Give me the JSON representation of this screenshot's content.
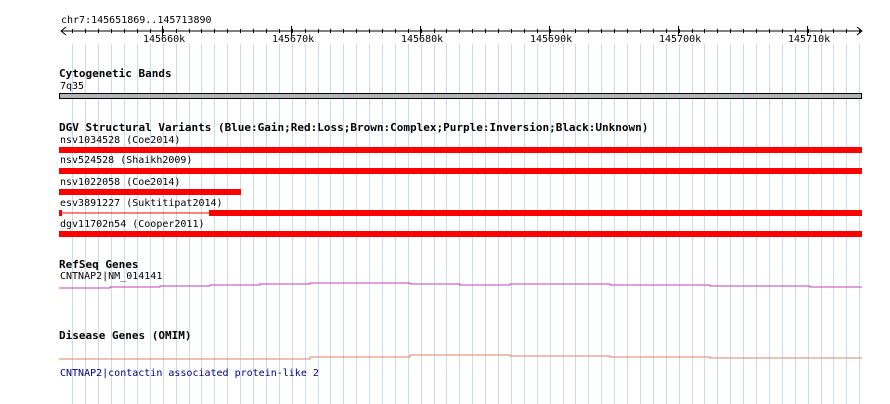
{
  "header": {
    "region": "chr7:145651869..145713890",
    "ticks": [
      "145660k",
      "145670k",
      "145680k",
      "145690k",
      "145700k",
      "145710k"
    ]
  },
  "tracks": {
    "cytoband": {
      "title": "Cytogenetic Bands",
      "band": "7q35"
    },
    "dgv": {
      "title": "DGV Structural Variants (Blue:Gain;Red:Loss;Brown:Complex;Purple:Inversion;Black:Unknown)",
      "variants": [
        "nsv1034528 (Coe2014)",
        "nsv524528 (Shaikh2009)",
        "nsv1022058 (Coe2014)",
        "esv3891227 (Suktitipat2014)",
        "dgv11702n54 (Cooper2011)"
      ]
    },
    "refseq": {
      "title": "RefSeq Genes",
      "gene": "CNTNAP2|NM_014141"
    },
    "omim": {
      "title": "Disease Genes (OMIM)",
      "gene": "CNTNAP2|contactin associated protein-like 2"
    }
  },
  "colors": {
    "loss": "#ff0000",
    "refseq": "#c040c0",
    "omim": "#e08060",
    "grid": "#c8dcf0",
    "link": "#000080"
  }
}
